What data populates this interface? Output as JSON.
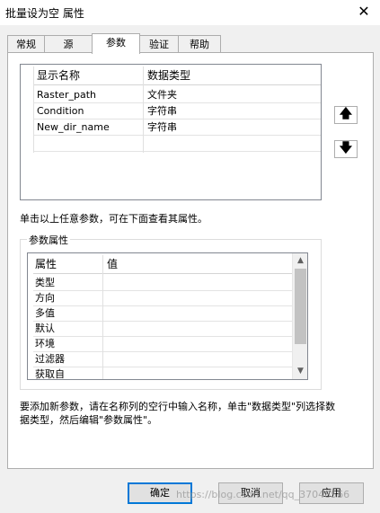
{
  "window": {
    "title": "批量设为空 属性",
    "close_glyph": "✕"
  },
  "tabs": [
    {
      "label": "常规"
    },
    {
      "label": "源"
    },
    {
      "label": "参数"
    },
    {
      "label": "验证"
    },
    {
      "label": "帮助"
    }
  ],
  "parameters_grid": {
    "headers": {
      "name": "显示名称",
      "type": "数据类型"
    },
    "rows": [
      {
        "name": "Raster_path",
        "type": "文件夹"
      },
      {
        "name": "Condition",
        "type": "字符串"
      },
      {
        "name": "New_dir_name",
        "type": "字符串"
      }
    ]
  },
  "move_buttons": {
    "up_glyph": "🡅",
    "down_glyph": "🡇"
  },
  "hint_text": "单击以上任意参数，可在下面查看其属性。",
  "param_properties": {
    "group_label": "参数属性",
    "headers": {
      "property": "属性",
      "value": "值"
    },
    "rows": [
      {
        "property": "类型",
        "value": ""
      },
      {
        "property": "方向",
        "value": ""
      },
      {
        "property": "多值",
        "value": ""
      },
      {
        "property": "默认",
        "value": ""
      },
      {
        "property": "环境",
        "value": ""
      },
      {
        "property": "过滤器",
        "value": ""
      },
      {
        "property": "获取自",
        "value": ""
      }
    ],
    "scroll_up_glyph": "▲",
    "scroll_down_glyph": "▼"
  },
  "instruction_text": "要添加新参数，请在名称列的空行中输入名称，单击\"数据类型\"列选择数据类型，然后编辑\"参数属性\"。",
  "footer": {
    "ok_label": "确定",
    "cancel_label": "取消",
    "apply_label": "应用"
  },
  "watermark": "https://blog.csdn.net/qq_37048566"
}
